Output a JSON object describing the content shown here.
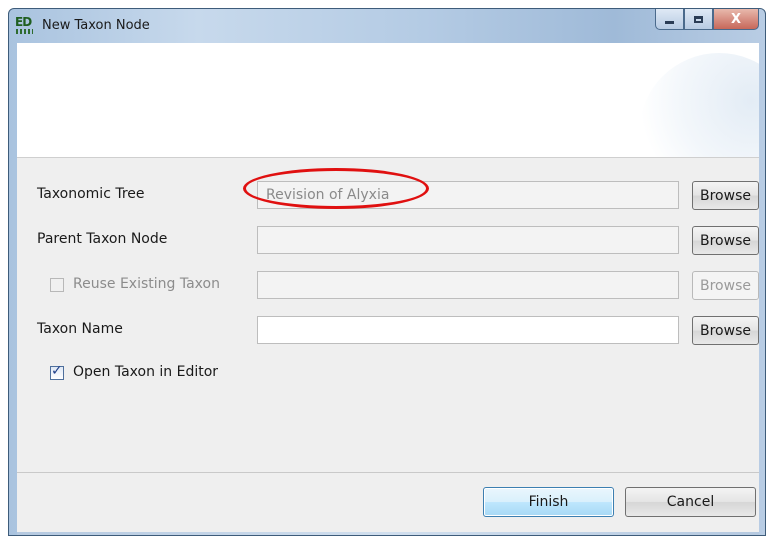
{
  "window": {
    "title": "New Taxon Node",
    "app_icon_text": "ED",
    "controls": {
      "minimize": "minimize",
      "maximize": "maximize",
      "close": "X"
    }
  },
  "form": {
    "taxonomic_tree": {
      "label": "Taxonomic Tree",
      "value": "Revision of Alyxia",
      "browse_label": "Browse",
      "highlighted": true
    },
    "parent_taxon_node": {
      "label": "Parent Taxon Node",
      "value": "",
      "browse_label": "Browse"
    },
    "reuse_existing_taxon": {
      "label": "Reuse Existing Taxon",
      "checked": false,
      "enabled": false,
      "value": "",
      "browse_label": "Browse"
    },
    "taxon_name": {
      "label": "Taxon Name",
      "value": "",
      "browse_label": "Browse"
    },
    "open_in_editor": {
      "label": "Open Taxon in Editor",
      "checked": true
    }
  },
  "footer": {
    "finish_label": "Finish",
    "cancel_label": "Cancel"
  },
  "colors": {
    "highlight_oval": "#e01010",
    "titlebar": "#b4cbe4",
    "panel_bg": "#efefef"
  }
}
